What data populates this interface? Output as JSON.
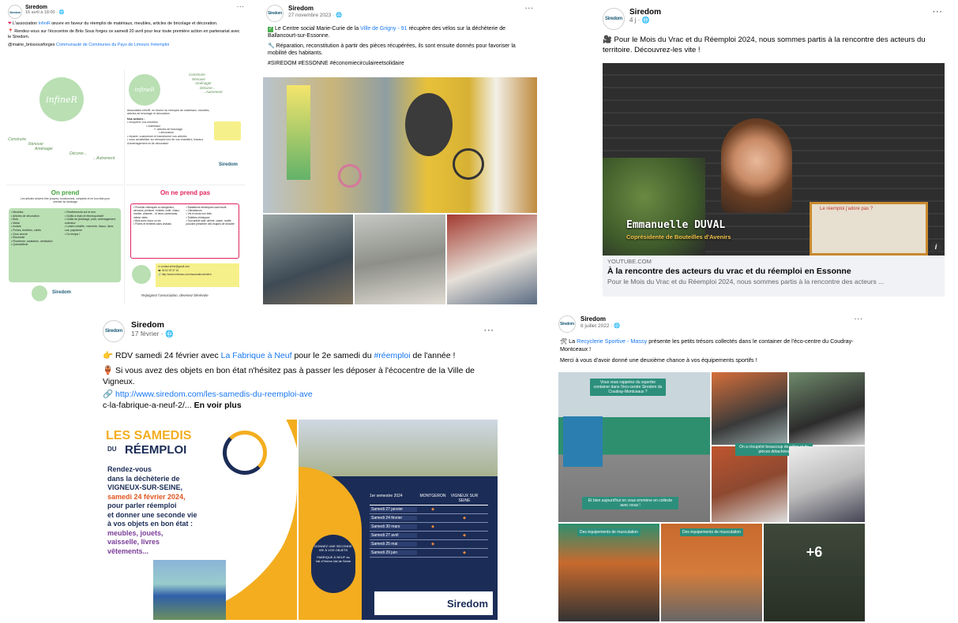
{
  "brand": "Siredom",
  "colors": {
    "link": "#1877f2",
    "meta": "#65676b",
    "green": "#2c8f7c",
    "yellow": "#f3ad1f",
    "navy": "#1b2c56"
  },
  "posts": [
    {
      "author": "Siredom",
      "date": "16 avril à 18:00 · ",
      "text1": "L'association ",
      "text1_link": "InfiniR",
      "text1_rest": " œuvre en faveur du réemploi de matériaux, meubles, articles de bricolage et décoration.",
      "text2": "Rendez-vous sur l'écocentre de Briis Sous forges ce samedi 20 avril pour leur toute première action en partenariat avec le Siredom.",
      "tags_plain": "@mairie_briissousforges ",
      "tags_link": "Communauté de Communes du Pays de Limours #réemploi",
      "flyer": {
        "logo": "infineR",
        "left_words": [
          "Construire",
          "Rénover",
          "Aménager",
          "Décorer...",
          "...Autrement"
        ],
        "right_words": [
          "Construire",
          "Rénover",
          "Aménager",
          "Décorer...",
          "...Autrement"
        ],
        "intro": "Association infiniR, en faveur du réemploi de matériaux, meubles, articles de bricolage et décoration",
        "actions_title": "Nos actions :",
        "actions": [
          "récupérer vos meubles",
          "matériaux",
          "articles de bricolage",
          "décoration",
          "réparer, customiser et transformer vos articles",
          "vous sensibiliser au réemploi lors de vos chantiers, travaux d'aménagement et de décoration"
        ],
        "on_prend": "On prend",
        "on_prend_sub": "Les articles doivent être propres, fonctionnels, complets et en bon état pour orienter au stockage",
        "prend_items": [
          "Meubles",
          "Articles de décoration",
          "Bois",
          "Métal",
          "Isolant",
          "Portes, fenêtres, volets",
          "Gros œuvre",
          "Électricité",
          "Plomberie, sanitaires, ventilation",
          "Quincaillerie",
          "Revêtements sol et mur",
          "Outils à main et électroportatif",
          "Outils de jardinage, pots, aménagement extérieur",
          "Loisirs créatifs : mercerie, tissus, laine, cuir, papeterie",
          "Du temps !"
        ],
        "on_prend_pas": "On ne prend pas",
        "pas_items": [
          "Produits chimiques ou dangereux, aérosols, peinture, enduits, colle, chaux, mortier, amiante... et leurs contenants, même vides",
          "Bois avec clous ou vis",
          "Portes et fenêtres sans châssis",
          "Radiateurs électriques sauf neufs",
          "Climatiseurs",
          "Vis et clous non triés",
          "Toilettes chimiques",
          "Tout article sale, abîmé, cassé, rouillé, pouvant présenter des risques de sécurité"
        ],
        "contact": [
          "contact.infinir@gmail.com",
          "06 62 29 37 16",
          "http://www.helloasso.com/associations/infinir"
        ],
        "join": "Rejoignez l'association, devenez bénévole",
        "stamp": "Siredom"
      }
    },
    {
      "author": "Siredom",
      "date": "27 novembre 2023 · ",
      "text1": "Le Centre social Marie-Curie de la ",
      "text1_link": "Ville de Grigny - 91",
      "text1_rest": " récupère des vélos sur la déchèterie de Ballancourt-sur-Essonne.",
      "text2": "Réparation, reconstitution à partir des pièces récupérées, ils sont ensuite donnés pour favoriser la mobilité des habitants.",
      "tags_link": "#SIREDOM #ESSONNE #économiecirculaireetsolidaire"
    },
    {
      "author": "Siredom",
      "date": "4 j · ",
      "text": "Pour le Mois du Vrac et du Réemploi 2024, nous sommes partis à la rencontre des acteurs du territoire. Découvrez-les vite !",
      "video": {
        "name": "Emmanuelle DUVAL",
        "role": "Coprésidente de Bouteilles d'Avenirs",
        "poster": "Le réemploi j'adore pas ?",
        "source": "YOUTUBE.COM",
        "title": "À la rencontre des acteurs du vrac et du réemploi en Essonne",
        "desc": "Pour le Mois du Vrac et du Réemploi 2024, nous sommes partis à la rencontre des acteurs ..."
      }
    },
    {
      "author": "Siredom",
      "date": "17 février · ",
      "line1a": "RDV samedi 24 février avec ",
      "line1_link": "La Fabrique à Neuf",
      "line1b": " pour le 2e samedi du ",
      "line1_link2": "#réemploi",
      "line1c": " de l'année !",
      "line2": "Si vous avez des objets en bon état n'hésitez pas à passer les déposer à l'écocentre de la Ville de Vigneux.",
      "url": "http://www.siredom.com/les-samedis-du-reemploi-ave",
      "url_rest": "c-la-fabrique-a-neuf-2/...",
      "see_more": "En voir plus",
      "flyer": {
        "title1": "LES SAMEDIS",
        "title2": "DU",
        "title3": "RÉEMPLOI",
        "body1": "Rendez-vous",
        "body2": "dans la déchèterie de",
        "body3": "VIGNEUX-SUR-SEINE,",
        "body4": "samedi 24 février 2024,",
        "body5": "pour parler réemploi",
        "body6": "et donner une seconde vie",
        "body7": "à vos objets en bon état :",
        "body8": "meubles, jouets,",
        "body9": "vaisselle, livres",
        "body10": "vêtements...",
        "table_head": [
          "1er semestre 2024",
          "MONTGERON",
          "VIGNEUX SUR SEINE"
        ],
        "rows": [
          {
            "date": "Samedi 27 janvier",
            "m": true,
            "v": false
          },
          {
            "date": "Samedi 24 février",
            "m": false,
            "v": true
          },
          {
            "date": "Samedi 30 mars",
            "m": true,
            "v": false
          },
          {
            "date": "Samedi 27 avril",
            "m": false,
            "v": true
          },
          {
            "date": "Samedi 25 mai",
            "m": true,
            "v": false
          },
          {
            "date": "Samedi 29 juin",
            "m": false,
            "v": true
          }
        ],
        "circle1": "DONNEZ UNE SECONDE VIE À VOS OBJETS",
        "circle2": "FABRIQUE À NEUF du Val d'Yerres Val de Seine",
        "logo": "Siredom"
      }
    },
    {
      "author": "Siredom",
      "date": "8 juillet 2022 · ",
      "text1": "La ",
      "text1_link": "Recyclerie Sportive - Massy",
      "text1_rest": " présente les petits trésors collectés dans le container de l'éco-centre du Coudray-Montceaux !",
      "text2": "Merci à vous d'avoir donné une deuxième chance à vos équipements sportifs !",
      "badges": [
        "Vous vous rappelez du superbe container dans l'éco-centre Siredom du Coudray-Montceaux ?",
        "On a récupéré beaucoup de vélos et de pièces détachées",
        "Et bien aujourd'hui on vous emmène en collecte avec nous !",
        "Des équipements de musculation",
        "Des équipements de musculation"
      ],
      "more_count": "+6"
    }
  ],
  "more_icon": "···"
}
